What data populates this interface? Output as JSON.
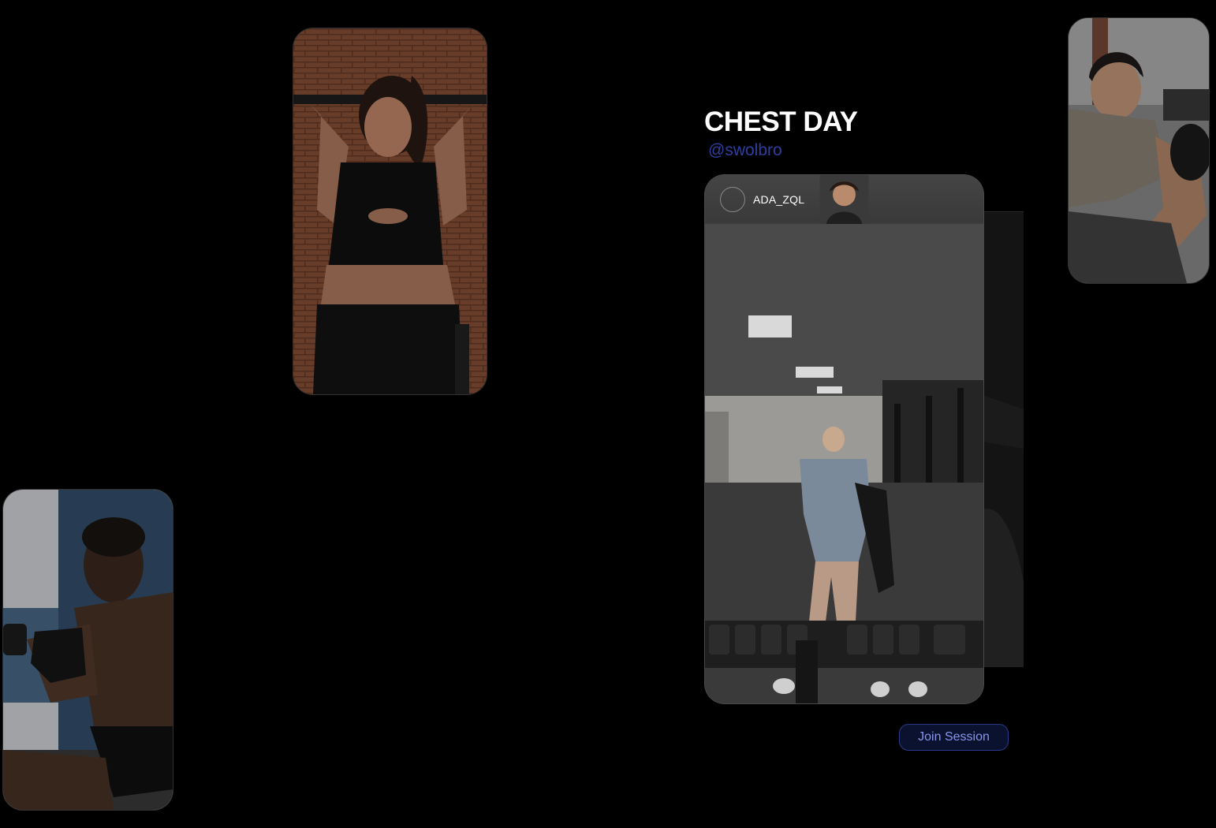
{
  "session": {
    "title": "CHEST DAY",
    "handle": "@swolbro",
    "join_label": "Join Session"
  },
  "post": {
    "username": "ADA_ZQL"
  },
  "icons": {
    "avatar": "user-avatar-photo"
  },
  "colors": {
    "background": "#000000",
    "title": "#ffffff",
    "handle": "#2f3fa0",
    "button_bg": "#0b1230",
    "button_border": "#2b3a8a",
    "button_text": "#8796ea"
  }
}
